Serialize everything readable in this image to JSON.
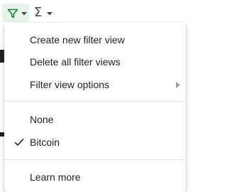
{
  "toolbar": {
    "filter_icon": "filter-funnel-icon",
    "functions_icon": "sigma-icon",
    "functions_glyph": "Σ",
    "filter_active_color": "#e6f4ea",
    "filter_icon_color": "#188038"
  },
  "menu": {
    "create_filter_view": "Create new filter view",
    "delete_all_filter_views": "Delete all filter views",
    "filter_view_options": "Filter view options",
    "views": [
      {
        "label": "None",
        "checked": false
      },
      {
        "label": "Bitcoin",
        "checked": true
      }
    ],
    "learn_more": "Learn more"
  }
}
